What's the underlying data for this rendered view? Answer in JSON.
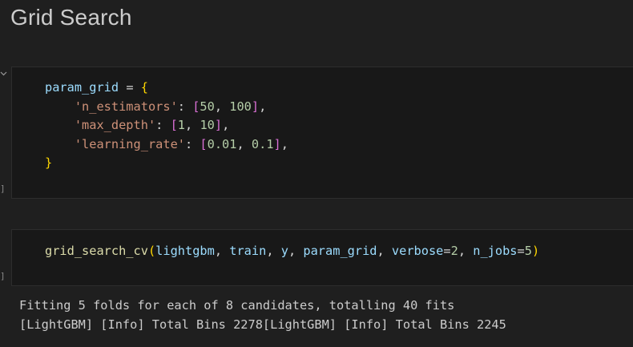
{
  "heading": "Grid Search",
  "cells": [
    {
      "gutter": "]",
      "collapse_icon": "chevron-down-icon",
      "lines": [
        [
          "param_grid",
          " = ",
          "{"
        ],
        [
          "'n_estimators'",
          ": ",
          "[",
          "50",
          ", ",
          "100",
          "]",
          ","
        ],
        [
          "'max_depth'",
          ": ",
          "[",
          "1",
          ", ",
          "10",
          "]",
          ","
        ],
        [
          "'learning_rate'",
          ": ",
          "[",
          "0.01",
          ", ",
          "0.1",
          "]",
          ","
        ],
        [
          "}"
        ]
      ]
    },
    {
      "gutter": "]",
      "call": {
        "fn": "grid_search_cv",
        "open": "(",
        "args": [
          "lightgbm",
          "train",
          "y",
          "param_grid"
        ],
        "kw1_name": "verbose",
        "kw1_val": "2",
        "kw2_name": "n_jobs",
        "kw2_val": "5",
        "close": ")",
        "sep": ", ",
        "eq": "="
      }
    }
  ],
  "output": {
    "line1": "Fitting 5 folds for each of 8 candidates, totalling 40 fits",
    "line2": "[LightGBM] [Info] Total Bins 2278[LightGBM] [Info] Total Bins 2245"
  },
  "colors": {
    "background": "#1f1f1f",
    "cell_background": "#181818",
    "string": "#ce9178",
    "number": "#b5cea8",
    "variable": "#9cdcfe",
    "function": "#dcdcaa",
    "brace": "#ffd700",
    "bracket": "#da70d6"
  }
}
